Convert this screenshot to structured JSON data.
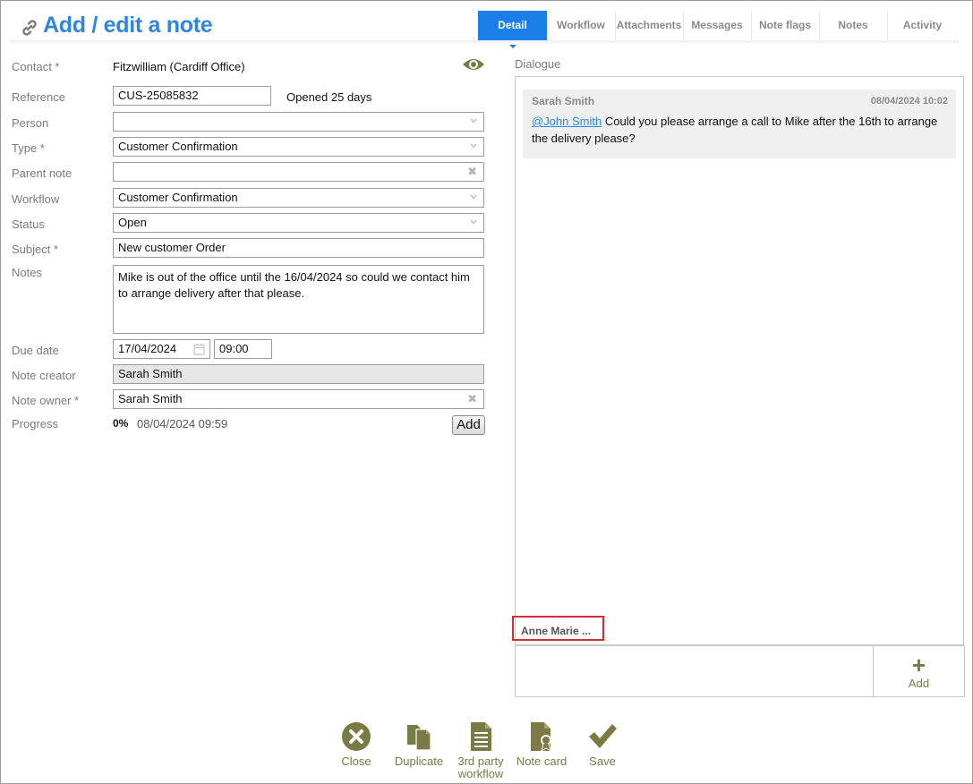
{
  "header": {
    "title": "Add / edit a note"
  },
  "tabs": [
    {
      "label": "Detail",
      "active": true
    },
    {
      "label": "Workflow"
    },
    {
      "label": "Attachments"
    },
    {
      "label": "Messages"
    },
    {
      "label": "Note flags"
    },
    {
      "label": "Notes"
    },
    {
      "label": "Activity"
    }
  ],
  "form": {
    "contact_label": "Contact *",
    "contact_value": "Fitzwilliam (Cardiff Office)",
    "reference_label": "Reference",
    "reference_value": "CUS-25085832",
    "opened_text": "Opened 25 days",
    "person_label": "Person",
    "person_value": "",
    "type_label": "Type *",
    "type_value": "Customer Confirmation",
    "parent_label": "Parent note",
    "parent_value": "",
    "workflow_label": "Workflow",
    "workflow_value": "Customer Confirmation",
    "status_label": "Status",
    "status_value": "Open",
    "subject_label": "Subject *",
    "subject_value": "New customer Order",
    "notes_label": "Notes",
    "notes_value": "Mike is out of the office until the 16/04/2024 so could we contact him to arrange delivery after that please.",
    "due_label": "Due date",
    "due_date": "17/04/2024",
    "due_time": "09:00",
    "creator_label": "Note creator",
    "creator_value": "Sarah Smith",
    "owner_label": "Note owner *",
    "owner_value": "Sarah Smith",
    "progress_label": "Progress",
    "progress_percent": "0%",
    "progress_timestamp": "08/04/2024 09:59",
    "add_button": "Add"
  },
  "dialogue": {
    "label": "Dialogue",
    "messages": [
      {
        "author": "Sarah Smith",
        "time": "08/04/2024 10:02",
        "mention": "@John Smith",
        "text": " Could you please arrange a call to Mike after the 16th to arrange the delivery please?"
      }
    ],
    "typing": "Anne Marie",
    "typing_dots": "...",
    "reply_add_label": "Add"
  },
  "actions": [
    {
      "label": "Close",
      "icon": "close-icon"
    },
    {
      "label": "Duplicate",
      "icon": "duplicate-icon"
    },
    {
      "label": "3rd party",
      "label2": "workflow",
      "icon": "document-icon"
    },
    {
      "label": "Note card",
      "icon": "note-card-icon"
    },
    {
      "label": "Save",
      "icon": "check-icon"
    }
  ],
  "colors": {
    "accent": "#1a7fe8",
    "title": "#2f86e0",
    "action": "#7a7a45",
    "highlight": "#d32f2f"
  }
}
